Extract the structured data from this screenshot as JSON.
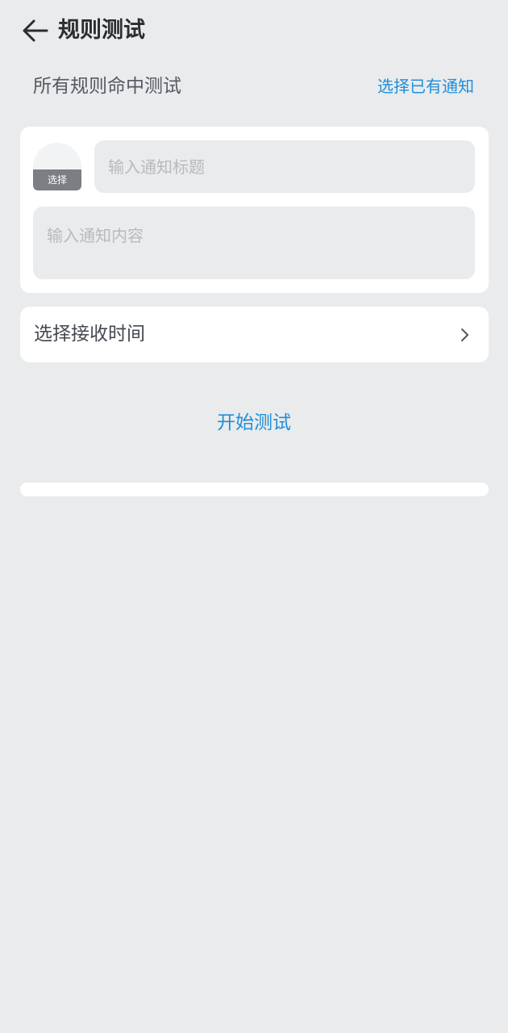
{
  "header": {
    "title": "规则测试",
    "back_icon": "arrow-left-icon"
  },
  "section": {
    "title": "所有规则命中测试",
    "select_existing": "选择已有通知"
  },
  "notification": {
    "icon_picker_label": "选择",
    "title_placeholder": "输入通知标题",
    "title_value": "",
    "content_placeholder": "输入通知内容",
    "content_value": ""
  },
  "receive_time": {
    "label": "选择接收时间",
    "chevron_icon": "chevron-right-icon"
  },
  "actions": {
    "start_test": "开始测试"
  },
  "colors": {
    "background": "#e9ebed",
    "card": "#ffffff",
    "accent": "#1f8fd8",
    "input_fill": "#e9ebed"
  }
}
